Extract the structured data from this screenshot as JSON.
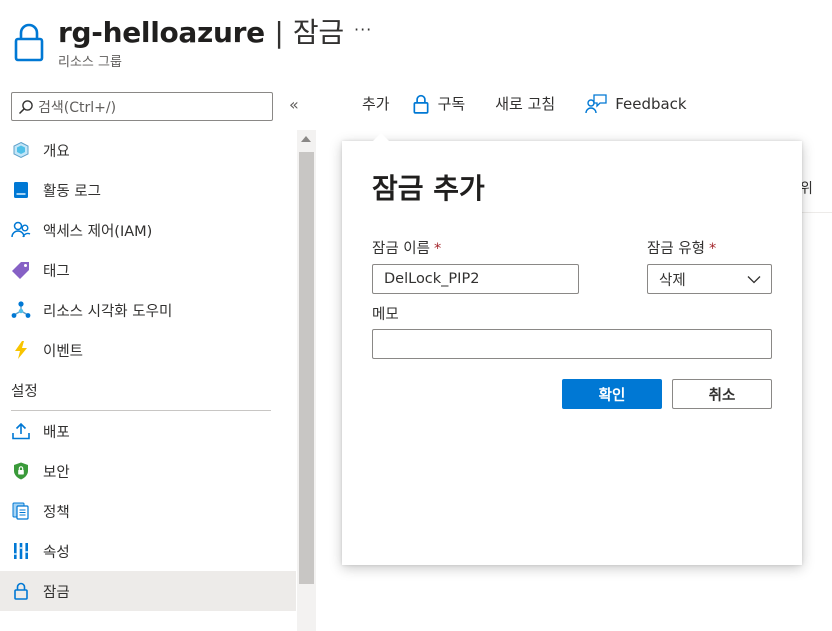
{
  "header": {
    "resource_name": "rg-helloazure",
    "separator": "|",
    "blade_title": "잠금",
    "subtitle": "리소스 그룹",
    "more_label": "···"
  },
  "sidebar": {
    "search_placeholder": "검색(Ctrl+/)",
    "collapse_label": "«",
    "items": [
      {
        "label": "개요",
        "icon": "overview-cube-icon"
      },
      {
        "label": "활동 로그",
        "icon": "activity-log-icon"
      },
      {
        "label": "액세스 제어(IAM)",
        "icon": "iam-people-icon"
      },
      {
        "label": "태그",
        "icon": "tag-icon"
      },
      {
        "label": "리소스 시각화 도우미",
        "icon": "resource-visualizer-icon"
      },
      {
        "label": "이벤트",
        "icon": "lightning-icon"
      }
    ],
    "section_label": "설정",
    "settings_items": [
      {
        "label": "배포",
        "icon": "deploy-upload-icon"
      },
      {
        "label": "보안",
        "icon": "shield-icon"
      },
      {
        "label": "정책",
        "icon": "policy-icon"
      },
      {
        "label": "속성",
        "icon": "properties-bars-icon"
      },
      {
        "label": "잠금",
        "icon": "lock-icon",
        "active": true
      }
    ]
  },
  "toolbar": {
    "add_label": "추가",
    "subscription_label": "구독",
    "refresh_label": "새로 고침",
    "feedback_label": "Feedback"
  },
  "background": {
    "partial_column_text": "위"
  },
  "panel": {
    "title": "잠금 추가",
    "lock_name_label": "잠금 이름",
    "lock_type_label": "잠금 유형",
    "required_mark": "*",
    "lock_name_value": "DelLock_PIP2",
    "lock_type_value": "삭제",
    "notes_label": "메모",
    "notes_value": "",
    "ok_label": "확인",
    "cancel_label": "취소"
  },
  "colors": {
    "accent": "#0078d4",
    "required": "#a4262c",
    "active_nav_bg": "#edebe9"
  }
}
